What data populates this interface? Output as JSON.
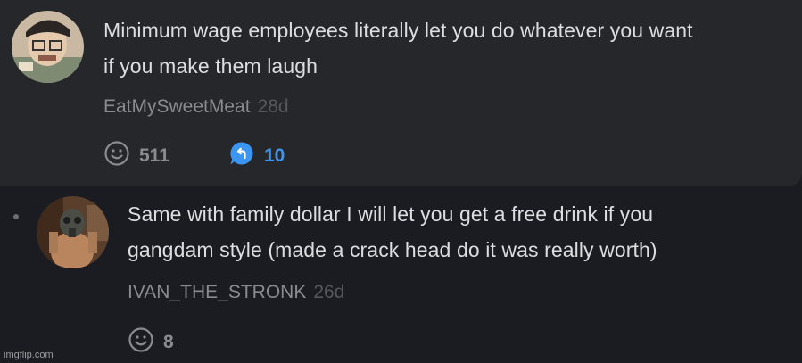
{
  "comment": {
    "text_line1": "Minimum wage employees literally let you do whatever you want",
    "text_line2": "if you make them laugh",
    "username": "EatMySweetMeat",
    "age": "28d",
    "reactions": "511",
    "replies": "10",
    "colors": {
      "reply_accent": "#3b95f2",
      "card_bg": "#26272b"
    },
    "icons": [
      "smiley-icon",
      "reply-bubble-icon"
    ]
  },
  "reply": {
    "text_line1": "Same with family dollar I will let you get a free drink if you",
    "text_line2": "gangdam style (made a crack head do it was really worth)",
    "username": "IVAN_THE_STRONK",
    "age": "26d",
    "reactions": "8",
    "icons": [
      "smiley-icon"
    ]
  },
  "watermark": "imgflip.com"
}
